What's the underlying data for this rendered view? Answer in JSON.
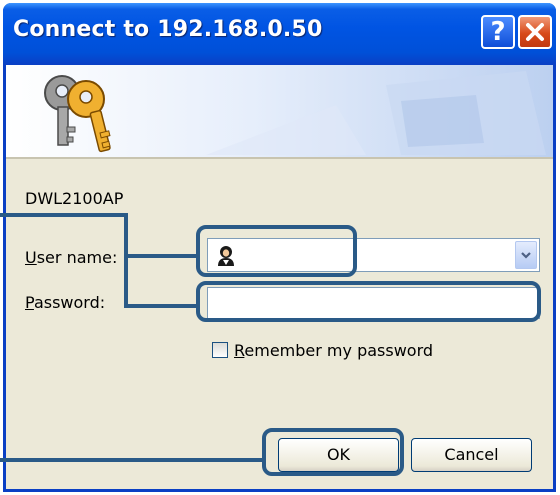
{
  "window": {
    "title": "Connect to 192.168.0.50",
    "help_button": "?",
    "close_button": "✕"
  },
  "form": {
    "realm": "DWL2100AP",
    "user_label_accel": "U",
    "user_label_rest": "ser name:",
    "user_value": "",
    "password_label_accel": "P",
    "password_label_rest": "assword:",
    "password_value": "",
    "remember_accel": "R",
    "remember_rest": "emember my password",
    "remember_checked": false
  },
  "buttons": {
    "ok": "OK",
    "cancel": "Cancel"
  },
  "icons": {
    "banner": "keys-icon",
    "user_field": "user-icon",
    "dropdown": "chevron-down-icon"
  },
  "colors": {
    "titlebar": "#0054e3",
    "callout": "#2a5a87",
    "dialog_bg": "#ece9d8"
  }
}
